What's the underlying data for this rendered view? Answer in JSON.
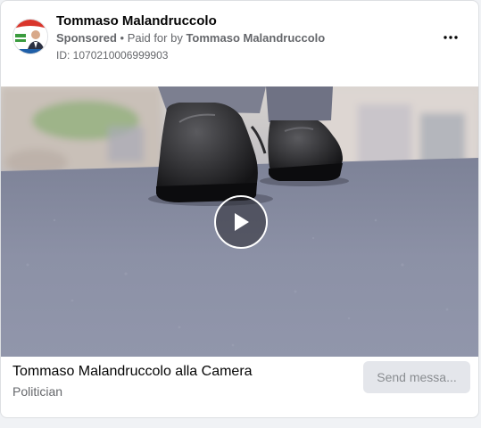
{
  "post": {
    "page_name": "Tommaso Malandruccolo",
    "sponsored_label": "Sponsored",
    "separator": " • ",
    "paid_for_by_label": "Paid for by ",
    "paid_for_by_name": "Tommaso Malandruccolo",
    "ad_id": "ID: 1070210006999903",
    "more_icon": "more-horizontal-icon"
  },
  "media": {
    "type": "video",
    "play_icon": "play-icon"
  },
  "footer": {
    "title": "Tommaso Malandruccolo alla Camera",
    "subtitle": "Politician",
    "cta_label": "Send messa..."
  },
  "colors": {
    "primary_text": "#050505",
    "secondary_text": "#65676b",
    "cta_background": "#e4e6eb",
    "cta_text": "#8a8d91"
  }
}
